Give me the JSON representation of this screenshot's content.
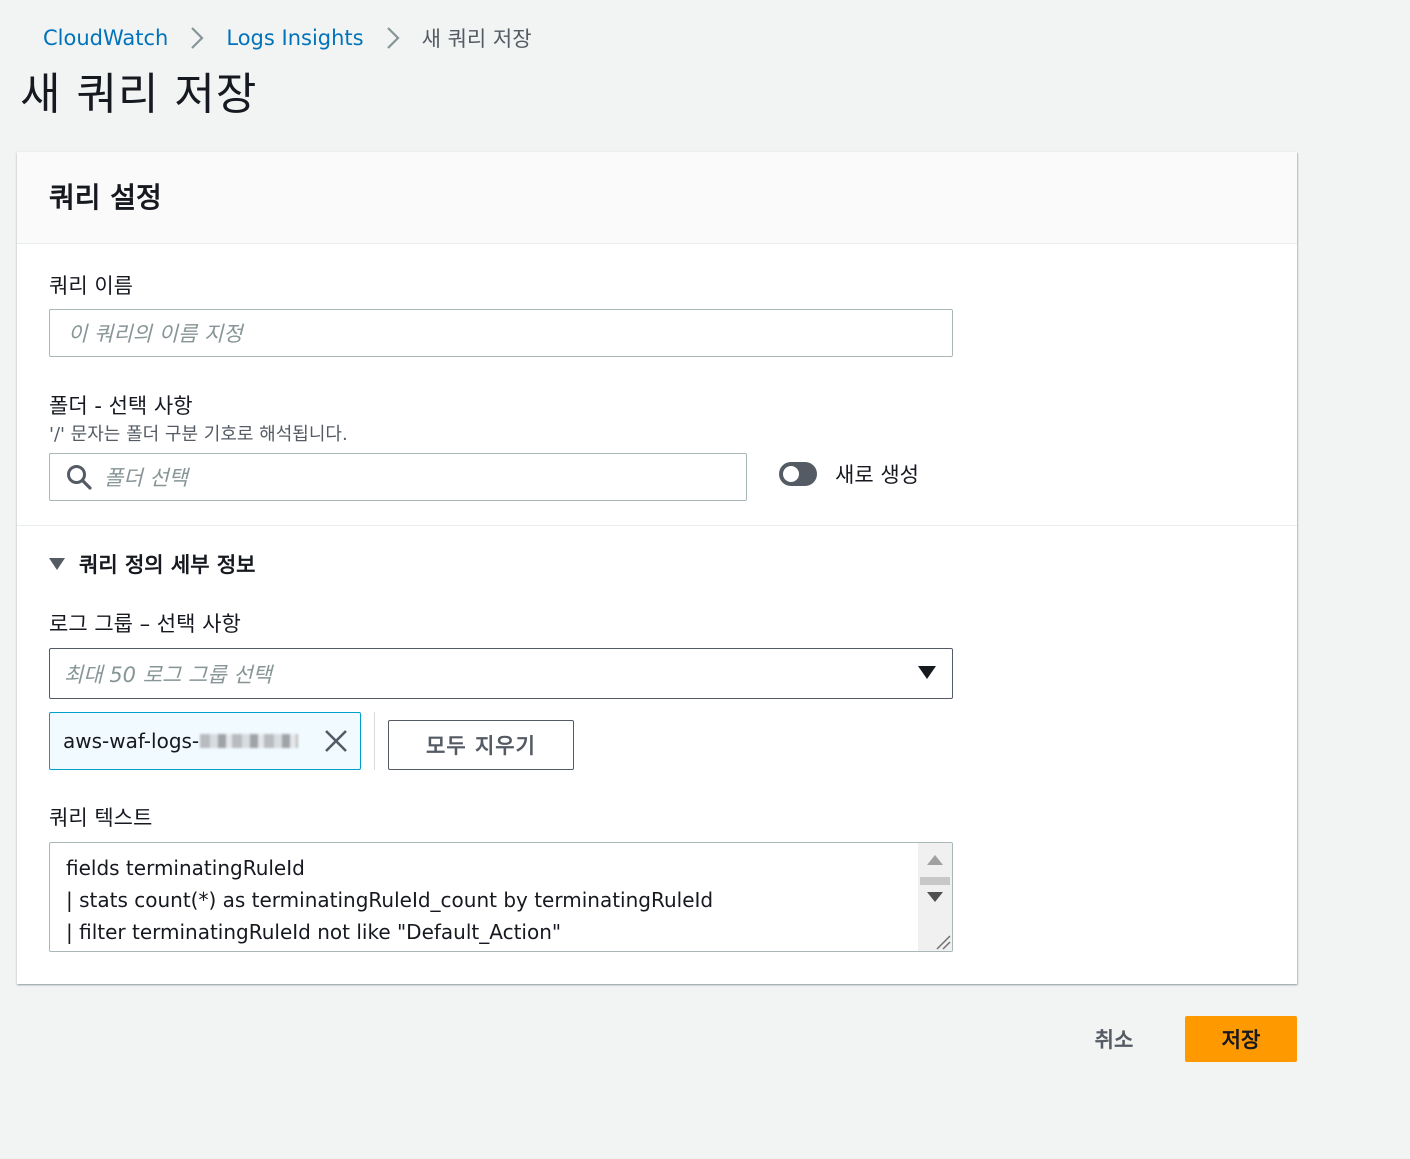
{
  "breadcrumb": {
    "items": [
      "CloudWatch",
      "Logs Insights"
    ],
    "current": "새 쿼리 저장"
  },
  "page": {
    "title": "새 쿼리 저장"
  },
  "panel": {
    "title": "쿼리 설정",
    "query_name": {
      "label": "쿼리 이름",
      "placeholder": "이 쿼리의 이름 지정",
      "value": ""
    },
    "folder": {
      "label": "폴더 - 선택 사항",
      "description": "'/' 문자는 폴더 구분 기호로 해석됩니다.",
      "placeholder": "폴더 선택",
      "toggle_label": "새로 생성",
      "toggle_on": false
    },
    "details": {
      "title": "쿼리 정의 세부 정보",
      "expanded": true,
      "log_group": {
        "label": "로그 그룹 – 선택 사항",
        "placeholder": "최대 50 로그 그룹 선택",
        "tokens": [
          "aws-waf-logs-"
        ],
        "clear_all_label": "모두 지우기"
      },
      "query_text": {
        "label": "쿼리 텍스트",
        "lines": [
          "fields terminatingRuleId",
          "| stats count(*) as terminatingRuleId_count by terminatingRuleId",
          "| filter terminatingRuleId not like \"Default_Action\""
        ]
      }
    }
  },
  "footer": {
    "cancel_label": "취소",
    "save_label": "저장"
  },
  "colors": {
    "link": "#0073bb",
    "primary": "#ff9900",
    "token_border": "#00a1c9",
    "toggle_off": "#545b64"
  },
  "icons": [
    "chevron-right-icon",
    "search-icon",
    "caret-down-icon",
    "close-icon",
    "scroll-up-icon",
    "scroll-down-icon",
    "resize-grip-icon"
  ]
}
